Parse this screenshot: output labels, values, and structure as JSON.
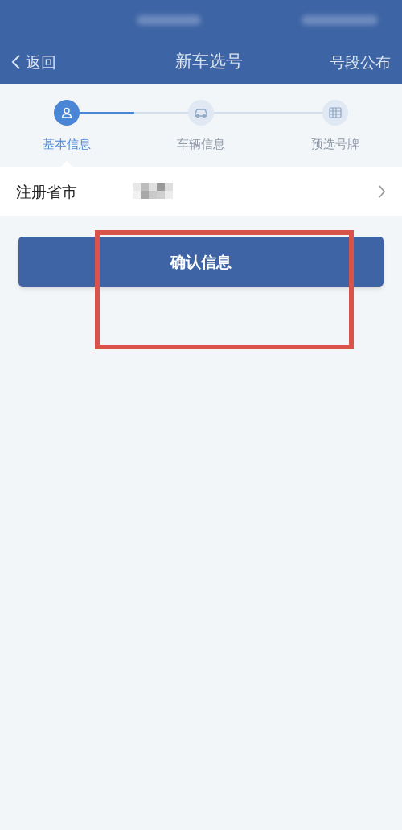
{
  "nav": {
    "back": "返回",
    "title": "新车选号",
    "action": "号段公布"
  },
  "steps": [
    {
      "label": "基本信息",
      "kind": "person",
      "selected": true
    },
    {
      "label": "车辆信息",
      "kind": "car",
      "selected": false
    },
    {
      "label": "预选号牌",
      "kind": "plate",
      "selected": false
    }
  ],
  "form": {
    "rows": [
      {
        "label": "注册省市"
      }
    ]
  },
  "confirm_button": "确认信息"
}
